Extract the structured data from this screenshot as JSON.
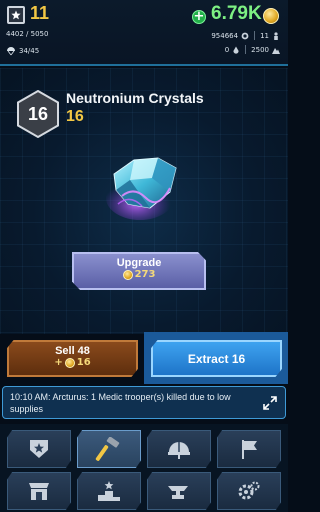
{
  "top": {
    "level": "11",
    "xp": "4402 / 5050",
    "population": "34/45",
    "coins": "6.79K",
    "resource_a": "954664",
    "resource_b": "11",
    "resource_c": "0",
    "resource_d": "2500"
  },
  "item": {
    "level": "16",
    "name": "Neutronium Crystals",
    "count": "16"
  },
  "upgrade": {
    "label": "Upgrade",
    "cost": "273"
  },
  "sell": {
    "label": "Sell 48",
    "value_prefix": "+",
    "value": "16"
  },
  "extract": {
    "label": "Extract 16"
  },
  "notification": {
    "text": "10:10 AM: Arcturus: 1 Medic trooper(s) killed due to low supplies"
  },
  "nav": [
    {
      "name": "base-icon"
    },
    {
      "name": "hammer-icon"
    },
    {
      "name": "helmet-icon"
    },
    {
      "name": "flag-icon"
    },
    {
      "name": "shop-icon"
    },
    {
      "name": "podium-icon"
    },
    {
      "name": "anvil-icon"
    },
    {
      "name": "gears-icon"
    }
  ],
  "colors": {
    "gold": "#f2c744",
    "green": "#7df083",
    "sell": "#8a4a1c",
    "extract": "#2f8fe0",
    "upgrade": "#7a80c2"
  }
}
